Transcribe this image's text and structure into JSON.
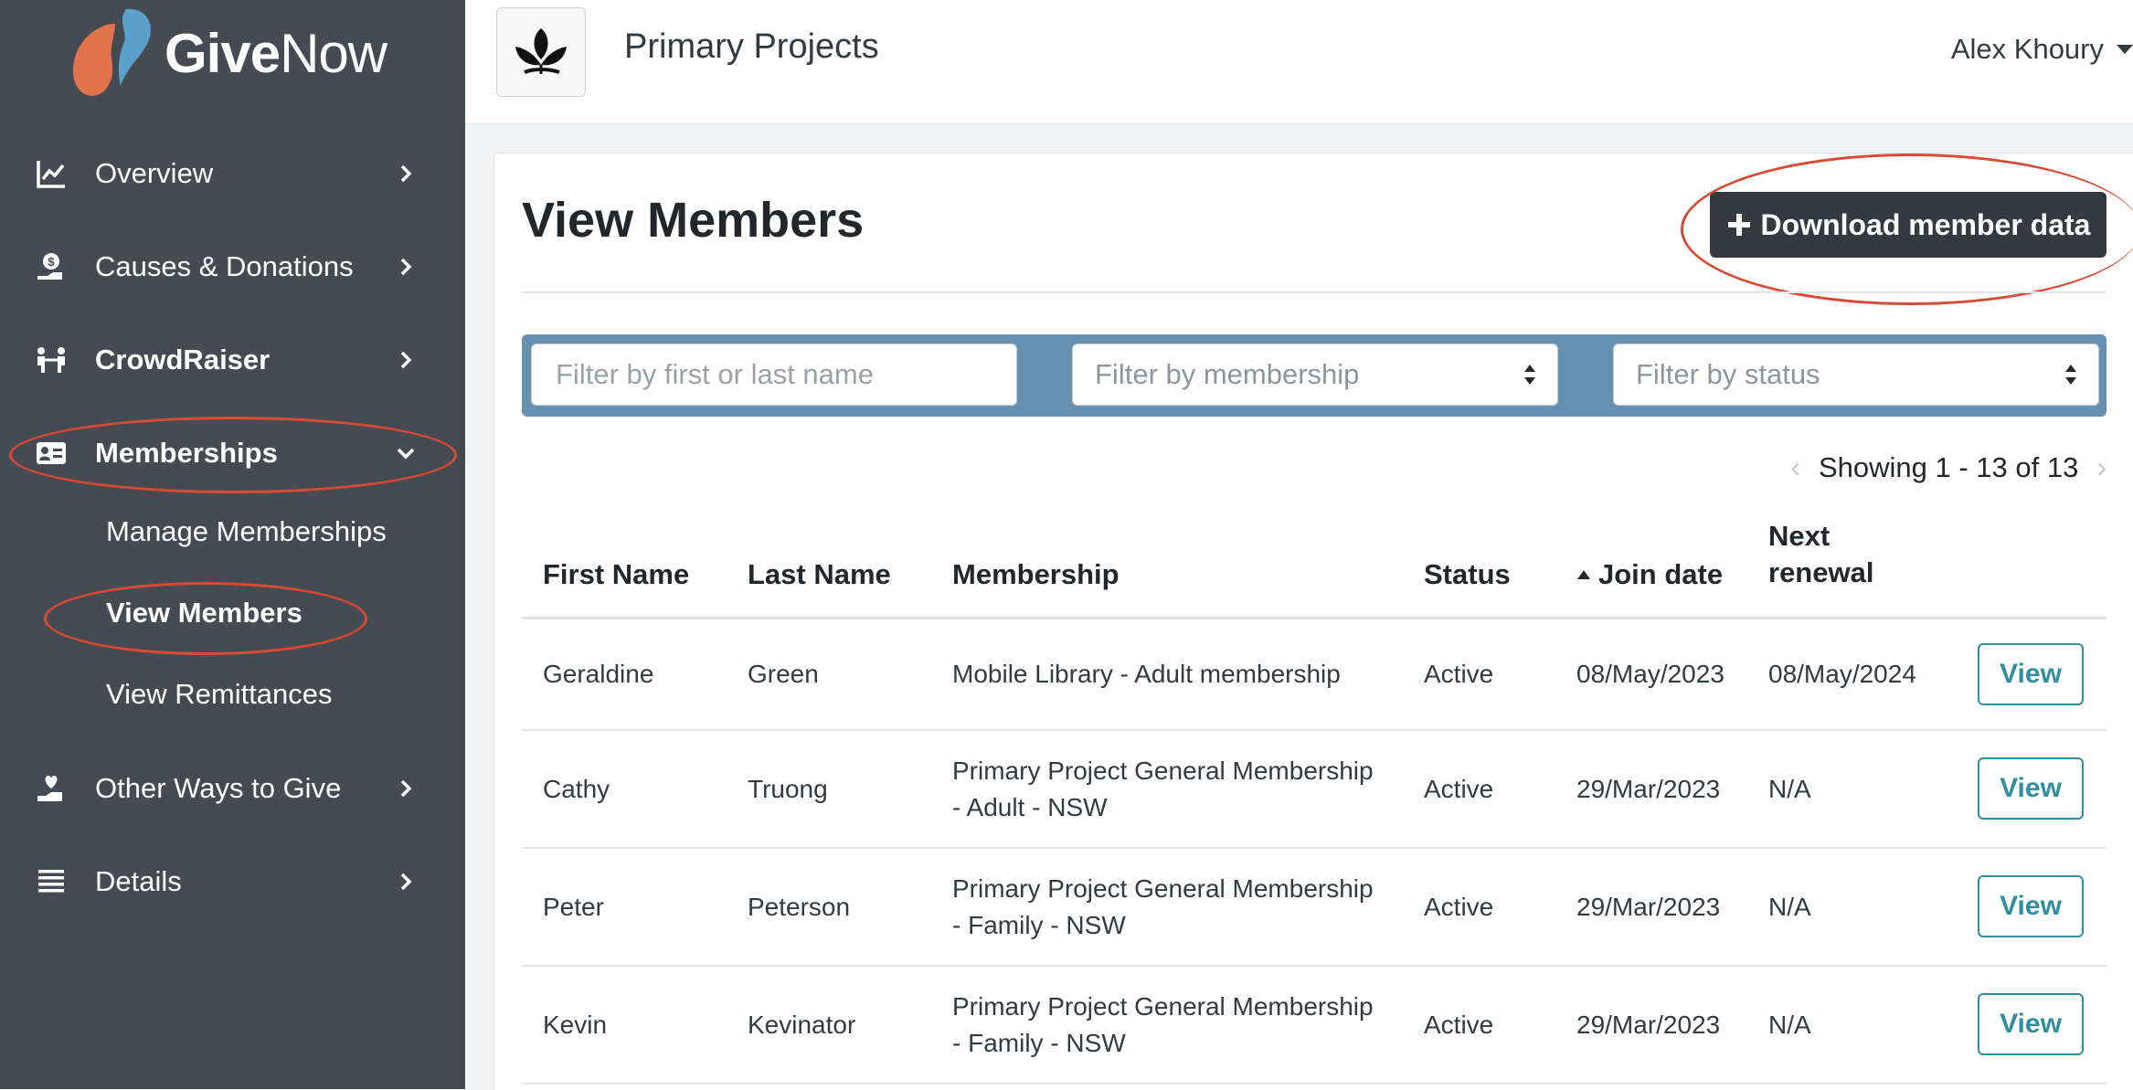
{
  "brand": {
    "part1": "Give",
    "part2": "Now"
  },
  "sidebar": {
    "items": [
      {
        "label": "Overview",
        "icon": "chart-line-icon"
      },
      {
        "label": "Causes & Donations",
        "icon": "donation-hand-icon"
      },
      {
        "label": "CrowdRaiser",
        "icon": "people-icon"
      },
      {
        "label": "Memberships",
        "icon": "id-card-icon",
        "expanded": true
      },
      {
        "label": "Other Ways to Give",
        "icon": "hand-heart-icon"
      },
      {
        "label": "Details",
        "icon": "list-icon"
      }
    ],
    "sub_items": [
      {
        "label": "Manage Memberships"
      },
      {
        "label": "View Members",
        "active": true
      },
      {
        "label": "View Remittances"
      }
    ]
  },
  "header": {
    "org_title": "Primary Projects",
    "user_name": "Alex Khoury"
  },
  "main": {
    "title": "View Members",
    "download_label": "Download member data",
    "filters": {
      "name_placeholder": "Filter by first or last name",
      "membership_placeholder": "Filter by membership",
      "status_placeholder": "Filter by status"
    },
    "pagination": "Showing 1 - 13 of 13",
    "columns": {
      "first_name": "First Name",
      "last_name": "Last Name",
      "membership": "Membership",
      "status": "Status",
      "join_date": "Join date",
      "next_renewal_1": "Next",
      "next_renewal_2": "renewal"
    },
    "rows": [
      {
        "first": "Geraldine",
        "last": "Green",
        "membership1": "Mobile Library - Adult membership",
        "membership2": "",
        "status": "Active",
        "join": "08/May/2023",
        "renewal": "08/May/2024",
        "action": "View"
      },
      {
        "first": "Cathy",
        "last": "Truong",
        "membership1": "Primary Project General Membership",
        "membership2": "- Adult - NSW",
        "status": "Active",
        "join": "29/Mar/2023",
        "renewal": "N/A",
        "action": "View"
      },
      {
        "first": "Peter",
        "last": "Peterson",
        "membership1": "Primary Project General Membership",
        "membership2": "- Family - NSW",
        "status": "Active",
        "join": "29/Mar/2023",
        "renewal": "N/A",
        "action": "View"
      },
      {
        "first": "Kevin",
        "last": "Kevinator",
        "membership1": "Primary Project General Membership",
        "membership2": "- Family - NSW",
        "status": "Active",
        "join": "29/Mar/2023",
        "renewal": "N/A",
        "action": "View"
      }
    ]
  },
  "colors": {
    "sidebar_bg": "#464a53",
    "filter_bar": "#6690b0",
    "annotation": "#d84a33",
    "view_button": "#2f8fa0",
    "download_button": "#343a40"
  }
}
